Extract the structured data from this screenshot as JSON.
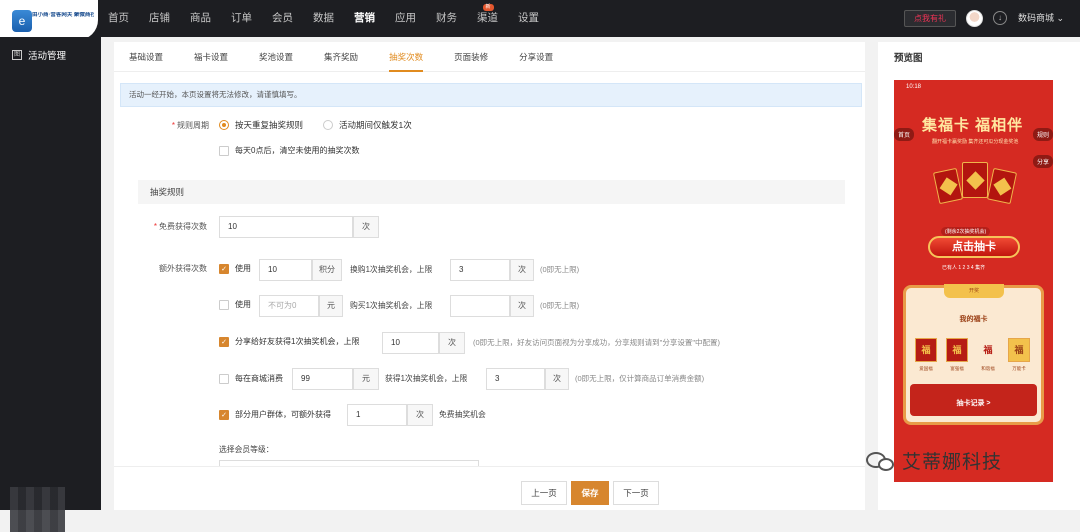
{
  "app": {
    "logo_glyph": "e",
    "logo_text": "由小商·营客网关 聚微商社交分销网络"
  },
  "nav": [
    {
      "label": "首页"
    },
    {
      "label": "店铺"
    },
    {
      "label": "商品"
    },
    {
      "label": "订单"
    },
    {
      "label": "会员"
    },
    {
      "label": "数据"
    },
    {
      "label": "营销",
      "active": true
    },
    {
      "label": "应用"
    },
    {
      "label": "财务"
    },
    {
      "label": "渠道",
      "badge": "新"
    },
    {
      "label": "设置"
    }
  ],
  "header": {
    "gift": "点我有礼",
    "download_icon": "↓",
    "shop": "数码商城",
    "shop_arrow": "⌄"
  },
  "sidebar": {
    "items": [
      {
        "label": "活动管理",
        "icon": "图"
      }
    ]
  },
  "tabs": [
    {
      "label": "基础设置"
    },
    {
      "label": "福卡设置"
    },
    {
      "label": "奖池设置"
    },
    {
      "label": "集齐奖励"
    },
    {
      "label": "抽奖次数",
      "active": true
    },
    {
      "label": "页面装修"
    },
    {
      "label": "分享设置"
    }
  ],
  "notice": "活动一经开始，本页设置将无法修改，请谨慎填写。",
  "rule_period": {
    "label": "规则周期",
    "options": [
      "按天重复抽奖规则",
      "活动期间仅触发1次"
    ],
    "clear_text": "每天0点后，清空未使用的抽奖次数"
  },
  "section_title": "抽奖规则",
  "free": {
    "label": "免费获得次数",
    "value": "10",
    "unit": "次"
  },
  "extra": {
    "label": "额外获得次数",
    "row1": {
      "use": "使用",
      "points": "10",
      "points_unit": "积分",
      "mid": "换购1次抽奖机会，上限",
      "limit": "3",
      "unit": "次",
      "hint": "(0即无上限)"
    },
    "row2": {
      "use": "使用",
      "amount_ph": "不可为0",
      "amount_unit": "元",
      "mid": "购买1次抽奖机会，上限",
      "unit": "次",
      "hint": "(0即无上限)"
    },
    "row3": {
      "text": "分享给好友获得1次抽奖机会，上限",
      "value": "10",
      "unit": "次",
      "hint": "(0即无上限，好友访问页面视为分享成功，分享规则请到\"分享设置\"中配置)"
    },
    "row4": {
      "text": "每在商城消费",
      "amount": "99",
      "amount_unit": "元",
      "mid": "获得1次抽奖机会，上限",
      "limit": "3",
      "unit": "次",
      "hint": "(0即无上限，仅计算商品订单消费金额)"
    },
    "row5": {
      "text": "部分用户群体，可额外获得",
      "value": "1",
      "unit": "次",
      "suffix": "免费抽奖机会"
    },
    "level_label": "选择会员等级："
  },
  "footer": {
    "prev": "上一页",
    "save": "保存",
    "next": "下一页"
  },
  "preview": {
    "title": "预览图",
    "time": "10:18",
    "headline": "集福卡 福相伴",
    "sub": "翻开福卡赢奖励  集齐还可瓜分现金奖池",
    "home": "首页",
    "rule": "规则",
    "share": "分享",
    "chance": "(剩余2次抽奖机会)",
    "draw": "点击抽卡",
    "have": "已有人 1 2 3 4 集齐",
    "open": "开奖",
    "mycards": "我的福卡",
    "cards": [
      {
        "c": "福",
        "l": "爱国福"
      },
      {
        "c": "福",
        "l": "富强福"
      },
      {
        "c": "福",
        "l": "和谐福"
      },
      {
        "c": "福",
        "l": "万能卡"
      }
    ],
    "record": "抽卡记录 >"
  },
  "watermark": "艾蒂娜科技"
}
